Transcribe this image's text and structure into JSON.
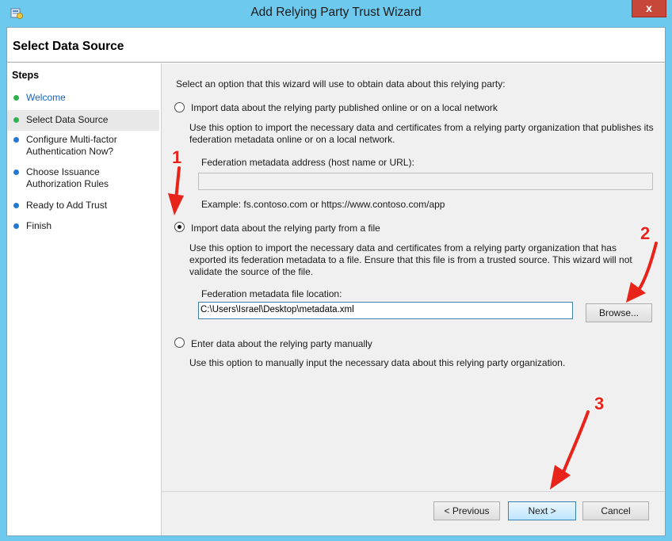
{
  "window": {
    "title": "Add Relying Party Trust Wizard",
    "close_label": "x"
  },
  "header": {
    "title": "Select Data Source"
  },
  "steps": {
    "title": "Steps",
    "items": [
      {
        "label": "Welcome",
        "status": "done"
      },
      {
        "label": "Select Data Source",
        "status": "current"
      },
      {
        "label": "Configure Multi-factor Authentication Now?",
        "status": "pending"
      },
      {
        "label": "Choose Issuance Authorization Rules",
        "status": "pending"
      },
      {
        "label": "Ready to Add Trust",
        "status": "pending"
      },
      {
        "label": "Finish",
        "status": "pending"
      }
    ]
  },
  "main": {
    "intro": "Select an option that this wizard will use to obtain data about this relying party:",
    "option_online": {
      "label": "Import data about the relying party published online or on a local network",
      "description": "Use this option to import the necessary data and certificates from a relying party organization that publishes its federation metadata online or on a local network.",
      "field_label": "Federation metadata address (host name or URL):",
      "field_value": "",
      "example": "Example: fs.contoso.com or https://www.contoso.com/app",
      "selected": false
    },
    "option_file": {
      "label": "Import data about the relying party from a file",
      "description": "Use this option to import the necessary data and certificates from a relying party organization that has exported its federation metadata to a file. Ensure that this file is from a trusted source.  This wizard will not validate the source of the file.",
      "field_label": "Federation metadata file location:",
      "field_value": "C:\\Users\\Israel\\Desktop\\metadata.xml",
      "browse_label": "Browse...",
      "selected": true
    },
    "option_manual": {
      "label": "Enter data about the relying party manually",
      "description": "Use this option to manually input the necessary data about this relying party organization.",
      "selected": false
    }
  },
  "footer": {
    "previous_label": "< Previous",
    "next_label": "Next >",
    "cancel_label": "Cancel"
  },
  "annotations": {
    "one": "1",
    "two": "2",
    "three": "3",
    "color": "#e8231a"
  },
  "colors": {
    "title_bar": "#6ec9ee",
    "close_button": "#c7473b",
    "step_done": "#2fb24b",
    "step_pending": "#2379d0",
    "link": "#1565c0"
  }
}
